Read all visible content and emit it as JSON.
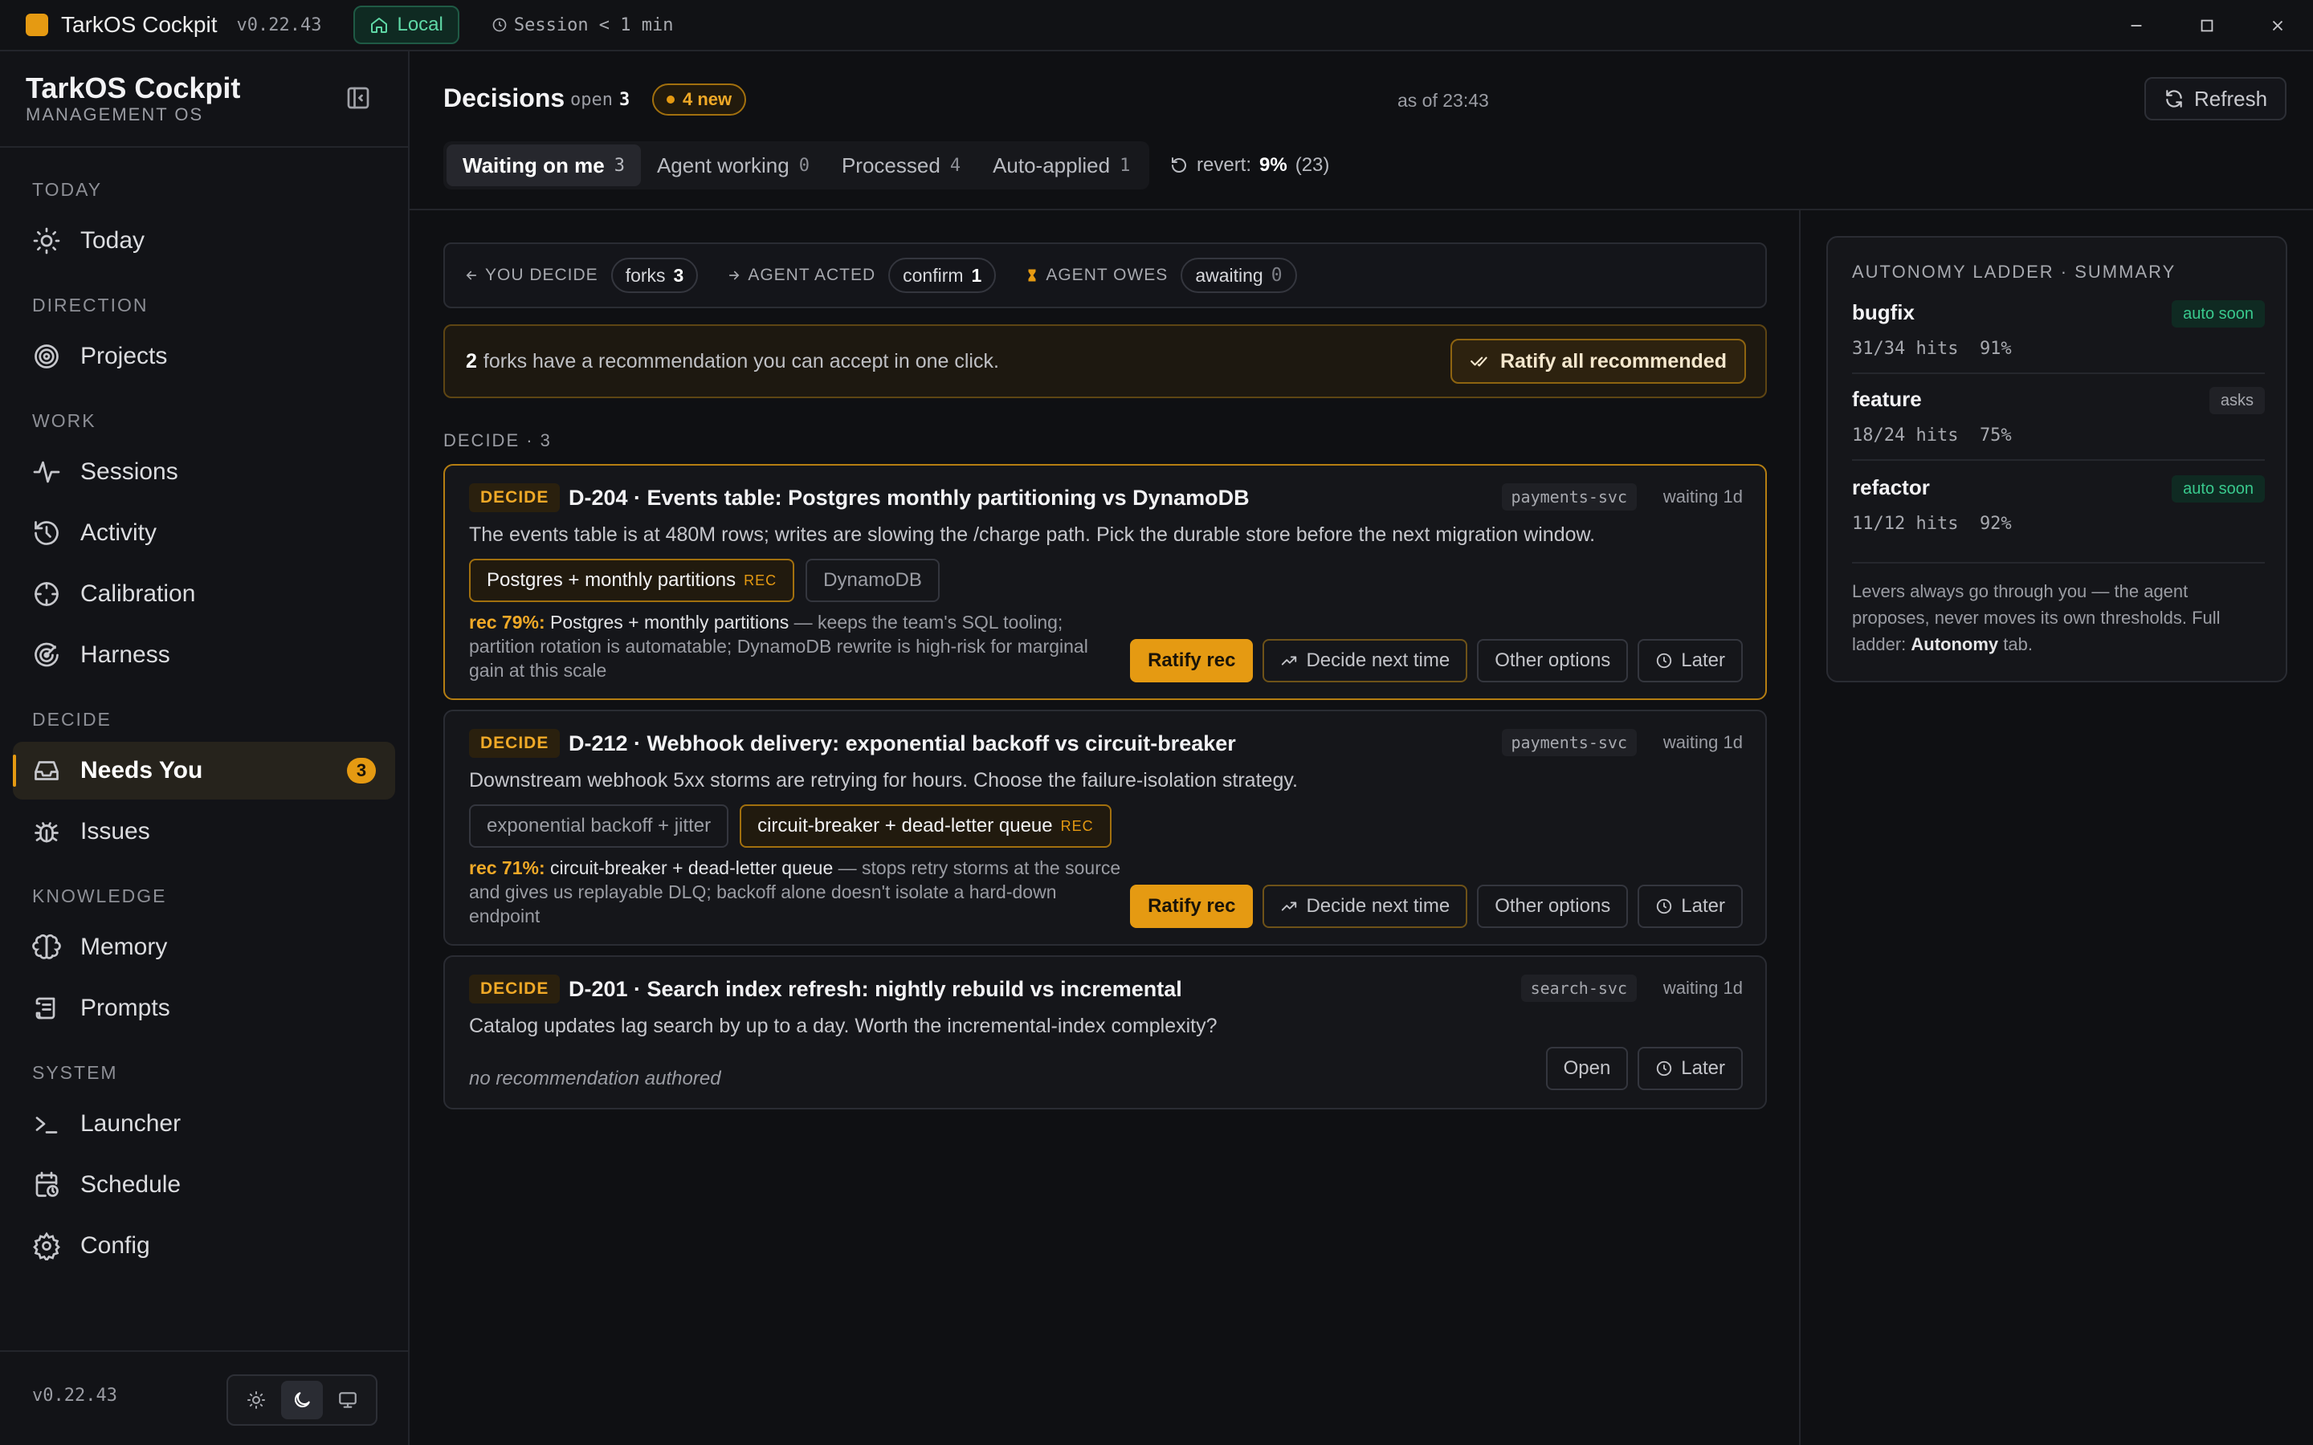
{
  "titlebar": {
    "app_name": "TarkOS Cockpit",
    "version": "v0.22.43",
    "env_label": "Local",
    "session": "Session < 1 min"
  },
  "sidebar": {
    "brand_title": "TarkOS Cockpit",
    "brand_sub": "MANAGEMENT OS",
    "sections": {
      "today": "TODAY",
      "direction": "DIRECTION",
      "work": "WORK",
      "decide": "DECIDE",
      "knowledge": "KNOWLEDGE",
      "system": "SYSTEM"
    },
    "items": {
      "today": "Today",
      "projects": "Projects",
      "sessions": "Sessions",
      "activity": "Activity",
      "calibration": "Calibration",
      "harness": "Harness",
      "needs_you": "Needs You",
      "needs_you_badge": "3",
      "issues": "Issues",
      "memory": "Memory",
      "prompts": "Prompts",
      "launcher": "Launcher",
      "schedule": "Schedule",
      "config": "Config"
    },
    "footer_version": "v0.22.43"
  },
  "header": {
    "title": "Decisions",
    "open_label": "open",
    "open_count": "3",
    "new_label": "4 new",
    "as_of": "as of 23:43",
    "refresh_label": "Refresh",
    "tabs": [
      {
        "label": "Waiting on me",
        "count": "3"
      },
      {
        "label": "Agent working",
        "count": "0"
      },
      {
        "label": "Processed",
        "count": "4"
      },
      {
        "label": "Auto-applied",
        "count": "1"
      }
    ],
    "revert_label": "revert:",
    "revert_pct": "9%",
    "revert_count": "(23)"
  },
  "flow": {
    "you_decide": "YOU DECIDE",
    "forks_label": "forks",
    "forks_count": "3",
    "agent_acted": "AGENT ACTED",
    "confirm_label": "confirm",
    "confirm_count": "1",
    "agent_owes": "AGENT OWES",
    "awaiting_label": "awaiting",
    "awaiting_count": "0"
  },
  "banner": {
    "count": "2",
    "text": "forks have a recommendation you can accept in one click.",
    "button": "Ratify all recommended"
  },
  "section_label": "DECIDE · 3",
  "cards": [
    {
      "badge": "DECIDE",
      "title": "D-204 · Events table: Postgres monthly partitioning vs DynamoDB",
      "service": "payments-svc",
      "waiting": "waiting 1d",
      "description": "The events table is at 480M rows; writes are slowing the /charge path. Pick the durable store before the next migration window.",
      "options": [
        {
          "label": "Postgres + monthly partitions",
          "rec": "REC"
        },
        {
          "label": "DynamoDB",
          "rec": ""
        }
      ],
      "rec_pct": "rec 79%:",
      "rec_pick": "Postgres + monthly partitions",
      "rec_reason": "— keeps the team's SQL tooling; partition rotation is automatable; DynamoDB rewrite is high-risk for marginal gain at this scale",
      "actions": {
        "ratify": "Ratify rec",
        "decide_next": "Decide next time",
        "other": "Other options",
        "later": "Later"
      }
    },
    {
      "badge": "DECIDE",
      "title": "D-212 · Webhook delivery: exponential backoff vs circuit-breaker",
      "service": "payments-svc",
      "waiting": "waiting 1d",
      "description": "Downstream webhook 5xx storms are retrying for hours. Choose the failure-isolation strategy.",
      "options": [
        {
          "label": "exponential backoff + jitter",
          "rec": ""
        },
        {
          "label": "circuit-breaker + dead-letter queue",
          "rec": "REC"
        }
      ],
      "rec_pct": "rec 71%:",
      "rec_pick": "circuit-breaker + dead-letter queue",
      "rec_reason": "— stops retry storms at the source and gives us replayable DLQ; backoff alone doesn't isolate a hard-down endpoint",
      "actions": {
        "ratify": "Ratify rec",
        "decide_next": "Decide next time",
        "other": "Other options",
        "later": "Later"
      }
    },
    {
      "badge": "DECIDE",
      "title": "D-201 · Search index refresh: nightly rebuild vs incremental",
      "service": "search-svc",
      "waiting": "waiting 1d",
      "description": "Catalog updates lag search by up to a day. Worth the incremental-index complexity?",
      "no_rec": "no recommendation authored",
      "actions": {
        "open": "Open",
        "later": "Later"
      }
    }
  ],
  "ladder": {
    "title": "AUTONOMY LADDER · SUMMARY",
    "rows": [
      {
        "name": "bugfix",
        "stat": "31/34 hits  91%",
        "tag": "auto soon"
      },
      {
        "name": "feature",
        "stat": "18/24 hits  75%",
        "tag": "asks"
      },
      {
        "name": "refactor",
        "stat": "11/12 hits  92%",
        "tag": "auto soon"
      }
    ],
    "note_pre": "Levers always go through you — the agent proposes, never moves its own thresholds. Full ladder:",
    "note_link": "Autonomy",
    "note_post": "tab."
  },
  "colors": {
    "accent": "#e59a12",
    "success": "#39c98d",
    "background": "#0f1013"
  }
}
